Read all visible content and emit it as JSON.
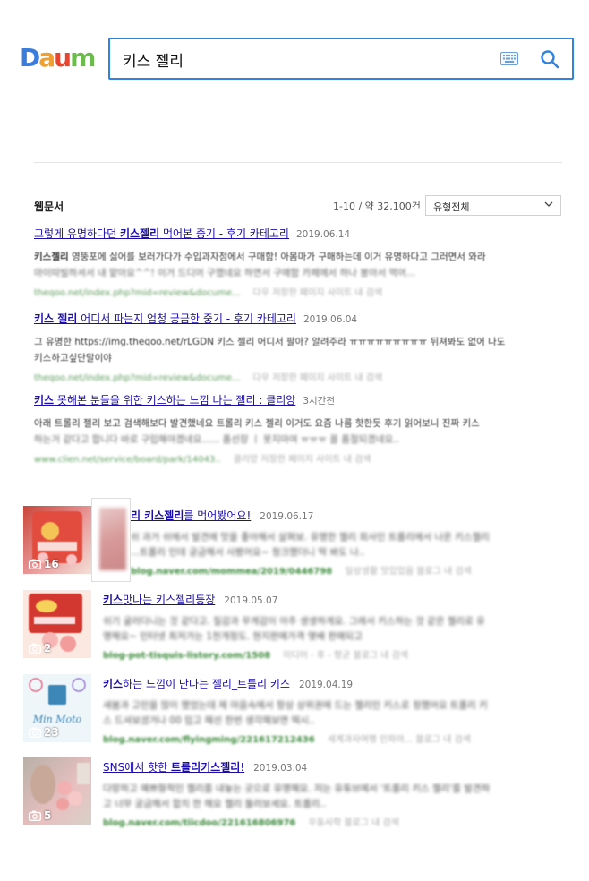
{
  "logo": {
    "letters": [
      "D",
      "a",
      "u",
      "m"
    ],
    "colors": [
      "#3b7ddd",
      "#f0a030",
      "#e8442e",
      "#6dbb4f"
    ]
  },
  "search": {
    "query": "키스 젤리"
  },
  "icons": {
    "keyboard": "keyboard-icon",
    "search": "search-icon",
    "camera": "camera-icon",
    "chevron": "chevron-down-icon"
  },
  "web": {
    "section_title": "웹문서",
    "count": "1-10 / 약 32,100건",
    "filter": "유형전체",
    "items": [
      {
        "title_pre": "그렇게 유명하다던 ",
        "title_bold": "키스젤리",
        "title_post": " 먹어본 중기 - 후기 카테고리",
        "date": "2019.06.14",
        "snippet_bold": "키스젤리",
        "snippet_text": " 영뚱포에 싫어를 보러가다가 수입과자점에서 구매함! 아몸마가 구매하는데 이거 유명하다고 그러면서 와라",
        "snippet_line2": "마이따빌하셔서 내 맡아요^^! 이거 드디어 구했네요 하면서 구매함 카페에서 하나 봉아서 먹어...",
        "url": "theqoo.net/index.php?mid=review&docume...",
        "meta": "다우   저장한 페이지   사이트 내 검색"
      },
      {
        "title_pre": "",
        "title_bold": "키스 젤리",
        "title_post": " 어디서 파는지 엄청 궁금한 중기 - 후기 카테고리",
        "date": "2019.06.04",
        "snippet_bold": "",
        "snippet_text": "그 유명한 https://img.theqoo.net/rLGDN 키스 젤리 어디서 팔아? 알려주라 ㅠㅠㅠㅠㅠㅠㅠㅠㅠ 뒤져봐도 없어 나도",
        "snippet_line2": "키스하고싶단말이야",
        "url": "theqoo.net/index.php?mid=review&docume...",
        "meta": "다우   저장한 페이지   사이트 내 검색"
      },
      {
        "title_pre": "",
        "title_bold": "키스",
        "title_post": " 못해본 분들을 위한 키스하는 느낌 나는 젤리 : 클리앙",
        "date": "3시간전",
        "snippet_bold": "",
        "snippet_text": "아래 트롤리 젤리 보고 검색해보다 발견했네요 트롤리 키스 젤리 이거도 요즘 나름 핫한듯 후기 읽어보니 진짜 키스",
        "snippet_line2": "하는거 같다고 합니다 바로 구입해야겠네요...... 품선장 ㅣ 못지마여 ㅠㅠㅠ 꼴 품절되겠네요..",
        "url": "www.clien.net/service/board/park/14043..",
        "meta": "클리앙   저장한 페이지   사이트 내 검색"
      }
    ]
  },
  "blogs": [
    {
      "photo_count": "16",
      "title_pre": "",
      "title_bold": "리 키스젤리",
      "title_post": "를 먹어봤어요!",
      "date": "2019.06.17",
      "snippet": "쉬 과거 쉬에서 발견에 맛을 좋아해서 살펴보. 유명한 젤리 회사인 트롤리에서 나온 키스젤리",
      "snippet2": "...트롤리 인데 궁금해서 사봤어요~ 청크했더니 딱 봐도 나..",
      "url": "blog.naver.com/mommea/2019/0446798",
      "meta": "일상생활 맛있었음   블로그 내 검색",
      "colors": [
        "#c9463a",
        "#e99a9a",
        "#f3e0d8"
      ]
    },
    {
      "photo_count": "2",
      "title_pre": "",
      "title_bold": "키스",
      "title_post": "맛나는 키스젤리등장",
      "date": "2019.05.07",
      "snippet": "쉬기 굴러다니는 것 같다고. 질감과 무게감이 아주 생생하게요. 그래서 키스하는 것 같은 젤리로 유",
      "snippet2": "명해요~ 인터넷 최저가는 1천개정도. 현지판매가격 몇배 판매되고",
      "url": "blog-pot-tisquis-listory.com/1508",
      "meta": "미디어 - 후 - 평균   블로그 내 검색",
      "colors": [
        "#c93c34",
        "#f0b0b0",
        "#fbe8e0"
      ]
    },
    {
      "photo_count": "23",
      "title_pre": "",
      "title_bold": "키스",
      "title_post": "하는 느낌이 난다는 젤리_트롤리 키스",
      "date": "2019.04.19",
      "snippet": "새봄과 고민을 많이 했었는데 제 마음속에서 항상 상위권에 드는 젤리인 키스로 정했어요 트롤리 키",
      "snippet2": "스 드셔보셨거나 00 입고 해선 한번 생각해보면 떡시..",
      "url": "blog.naver.com/flyingming/221617212436",
      "meta": "세계과자여행 인파마...   블로그 내 검색",
      "colors": [
        "#e8f3f8",
        "#4a8fb8",
        "#6aa6c8"
      ]
    },
    {
      "photo_count": "5",
      "title_pre": "SNS에서 핫한 ",
      "title_bold": "트롤리키스젤리",
      "title_post": "!",
      "date": "2019.03.04",
      "snippet": "다망하고 예쁘형적인 젤리를 내놓는 곳으로 유명해요. 저는 유튜브에서 '트롤리 키스 젤리'를 발견하",
      "snippet2": "고 너무 궁금해서 합치 한 해요 젤리 둘러보세요. 트롤리..",
      "url": "blog.naver.com/tiicdoo/221616806976",
      "meta": "우동사학   블로그 내 검색",
      "colors": [
        "#b8b0a8",
        "#e8c0c0",
        "#d8d0c8"
      ]
    }
  ]
}
